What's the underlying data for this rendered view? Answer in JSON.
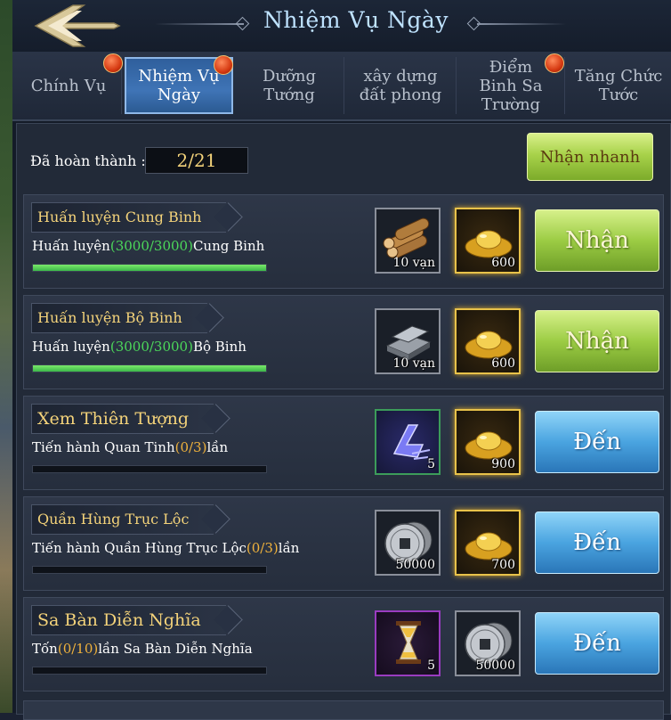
{
  "header": {
    "title": "Nhiệm Vụ Ngày"
  },
  "tabs": [
    {
      "label": "Chính Vụ",
      "badge": true,
      "active": false
    },
    {
      "label": "Nhiệm Vụ Ngày",
      "badge": true,
      "active": true
    },
    {
      "label": "Dưỡng Tướng",
      "badge": false,
      "active": false
    },
    {
      "label": "xây dựng đất phong",
      "badge": false,
      "active": false
    },
    {
      "label": "Điểm Binh Sa Trường",
      "badge": true,
      "active": false
    },
    {
      "label": "Tăng Chức Tước",
      "badge": false,
      "active": false
    }
  ],
  "summary": {
    "done_label": "Đã hoàn thành :",
    "done_value": "2/21",
    "quick_button": "Nhận nhanh"
  },
  "tasks": [
    {
      "title": "Huấn luyện Cung Binh",
      "desc_pre": "Huấn luyện",
      "desc_progress": "(3000/3000)",
      "desc_post": "Cung Binh",
      "progress": 1.0,
      "rewards": [
        {
          "icon": "wood-icon",
          "count": "10 vạn"
        },
        {
          "icon": "gold-ingot-icon",
          "count": "600"
        }
      ],
      "action": "Nhận"
    },
    {
      "title": "Huấn luyện Bộ Binh",
      "desc_pre": "Huấn luyện",
      "desc_progress": "(3000/3000)",
      "desc_post": "Bộ Binh",
      "progress": 1.0,
      "rewards": [
        {
          "icon": "iron-icon",
          "count": "10 vạn"
        },
        {
          "icon": "gold-ingot-icon",
          "count": "600"
        }
      ],
      "action": "Nhận"
    },
    {
      "title": "Xem Thiên Tượng",
      "desc_pre": "Tiến hành Quan Tinh",
      "desc_progress": "(0/3)",
      "desc_post": "lần",
      "progress": 0.0,
      "rewards": [
        {
          "icon": "speedup-icon",
          "count": "5"
        },
        {
          "icon": "gold-ingot-icon",
          "count": "900"
        }
      ],
      "action": "Đến"
    },
    {
      "title": "Quần Hùng Trục Lộc",
      "desc_pre": "Tiến hành Quần Hùng Trục Lộc",
      "desc_progress": "(0/3)",
      "desc_post": "lần",
      "progress": 0.0,
      "rewards": [
        {
          "icon": "coin-icon",
          "count": "50000"
        },
        {
          "icon": "gold-ingot-icon",
          "count": "700"
        }
      ],
      "action": "Đến"
    },
    {
      "title": "Sa Bàn Diễn Nghĩa",
      "desc_pre": "Tốn",
      "desc_progress": "(0/10)",
      "desc_post": "lần Sa Bàn Diễn Nghĩa",
      "progress": 0.0,
      "rewards": [
        {
          "icon": "hourglass-icon",
          "count": "5"
        },
        {
          "icon": "coin-icon",
          "count": "50000"
        }
      ],
      "action": "Đến"
    }
  ]
}
